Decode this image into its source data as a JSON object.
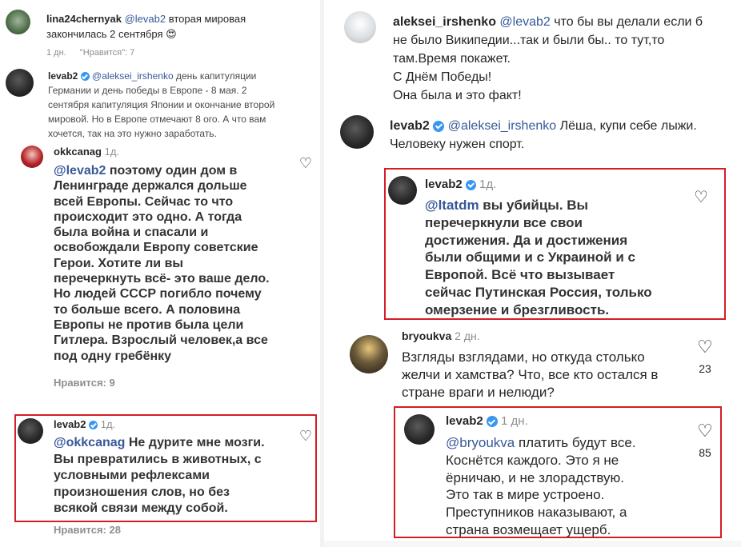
{
  "left": {
    "c1": {
      "username": "lina24chernyak",
      "mention": "@levab2",
      "text": " вторая мировая\nзакончилась 2 сентября 😍",
      "time": "1 дн.",
      "likes": "\"Нравится\": 7"
    },
    "c2": {
      "username": "levab2",
      "mention": "@aleksei_irshenko",
      "text": " день капитуляции\nГермании и день победы в Европе - 8 мая. 2\nсентября капитуляция Японии и окончание второй\nмировой. Но в Европе отмечают 8 ого. А что вам\nхочется, так на это нужно заработать."
    },
    "c3": {
      "username": "okkcanag",
      "time": "1д.",
      "mention": "@levab2",
      "text": " поэтому один дом в\nЛенинграде держался дольше\nвсей Европы. Сейчас то что\nпроисходит это одно. А тогда\nбыла война и спасали и\nосвобождали Европу советские\nГерои. Хотите ли вы\nперечеркнуть всё- это ваше дело.\nНо людей СССР погибло почему\nто больше всего. А половина\nЕвропы не против была цели\nГитлера. Взрослый человек,а все\nпод одну гребёнку",
      "likes": "Нравится: 9"
    },
    "c4": {
      "username": "levab2",
      "time": "1д.",
      "mention": "@okkcanag",
      "text": " Не дурите мне мозги.\nВы превратились в животных, с\nусловными рефлексами\nпроизношения слов, но без\nвсякой связи между собой.",
      "likes": "Нравится: 28"
    }
  },
  "right": {
    "c1": {
      "username": "aleksei_irshenko",
      "mention": "@levab2",
      "text": " что бы вы делали если б\nне было Википедии...так и были бы.. то тут,то\nтам.Время покажет.\nС Днём Победы!\nОна была и это факт!"
    },
    "c2": {
      "username": "levab2",
      "mention": "@aleksei_irshenko",
      "text": " Лёша, купи себе лыжи.\nЧеловеку нужен спорт."
    },
    "c3": {
      "username": "levab2",
      "time": "1д.",
      "mention": "@ltatdm",
      "text": " вы убийцы. Вы\nперечеркнули все свои\nдостижения. Да и достижения\nбыли общими и с Украиной и с\nЕвропой. Всё что вызывает\nсейчас Путинская Россия, только\nомерзение и брезгливость."
    },
    "c4": {
      "username": "bryoukva",
      "time": "2 дн.",
      "text": "Взгляды взглядами, но откуда столько\nжелчи и хамства? Что, все кто остался в\nстране враги и нелюди?",
      "like_count": "23"
    },
    "c5": {
      "username": "levab2",
      "time": "1 дн.",
      "mention": "@bryoukva",
      "text": " платить будут все.\nКоснётся каждого. Это я не\nёрничаю, и не злорадствую.\nЭто так в мире устроено.\nПреступников наказывают, а\nстрана возмещает ущерб.",
      "like_count": "85"
    }
  },
  "icons": {
    "heart": "♡"
  },
  "colors": {
    "highlight_box": "#d31e24",
    "mention": "#385898",
    "verified": "#3897f0",
    "muted": "#8e8e8e"
  }
}
